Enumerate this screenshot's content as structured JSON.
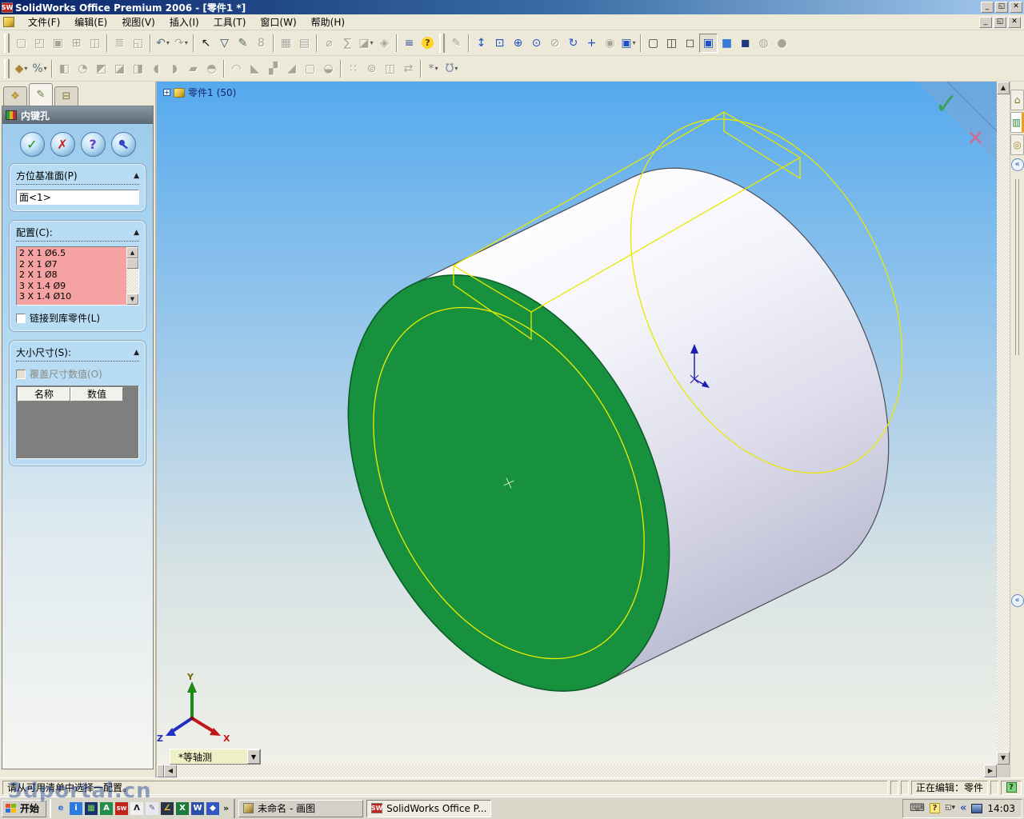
{
  "window": {
    "title": "SolidWorks Office Premium 2006 - [零件1 *]"
  },
  "menu": [
    "文件(F)",
    "编辑(E)",
    "视图(V)",
    "插入(I)",
    "工具(T)",
    "窗口(W)",
    "帮助(H)"
  ],
  "toolbars": {
    "row1": [
      {
        "grip": true
      },
      {
        "n": "new-document-icon",
        "g": "▢",
        "c": "#9a9a8c",
        "s": "off"
      },
      {
        "n": "open-document-icon",
        "g": "◰",
        "c": "#a89a6a",
        "s": "off"
      },
      {
        "n": "save-icon",
        "g": "▣",
        "c": "#9a9a8c",
        "s": "off"
      },
      {
        "n": "make-drawing-icon",
        "g": "⊞",
        "c": "#9a9a8c",
        "s": "off"
      },
      {
        "n": "make-assembly-icon",
        "g": "◫",
        "c": "#9a9a8c",
        "s": "off"
      },
      {
        "sep": true
      },
      {
        "n": "print-icon",
        "g": "≣",
        "c": "#9a9a8c",
        "s": "off"
      },
      {
        "n": "print-preview-icon",
        "g": "◱",
        "c": "#9a9a8c",
        "s": "off"
      },
      {
        "sep": true
      },
      {
        "n": "undo-icon",
        "g": "↶",
        "c": "#5a748e",
        "s": "on",
        "caret": true
      },
      {
        "n": "redo-icon",
        "g": "↷",
        "c": "#a0a094",
        "s": "off",
        "caret": true
      },
      {
        "sep": true
      },
      {
        "n": "select-icon",
        "g": "↖",
        "c": "#1a1a1a",
        "s": "on"
      },
      {
        "n": "select-filter-icon",
        "g": "▽",
        "c": "#3a4a6a",
        "s": "on"
      },
      {
        "n": "sketch-icon",
        "g": "✎",
        "c": "#5a6a5a",
        "s": "on"
      },
      {
        "n": "bead-icon",
        "g": "8",
        "c": "#9a9a8c",
        "s": "off"
      },
      {
        "sep": true
      },
      {
        "n": "grid-icon",
        "g": "▦",
        "c": "#9a9a8c",
        "s": "off"
      },
      {
        "n": "hatch-icon",
        "g": "▤",
        "c": "#a89a7a",
        "s": "off"
      },
      {
        "sep": true
      },
      {
        "n": "measure-icon",
        "g": "⌀",
        "c": "#9a9a8c",
        "s": "off"
      },
      {
        "n": "mass-properties-icon",
        "g": "∑",
        "c": "#9a9a8c",
        "s": "off"
      },
      {
        "n": "section-properties-icon",
        "g": "◪",
        "c": "#9a9a8c",
        "s": "off",
        "caret": true
      },
      {
        "n": "check-icon",
        "g": "◈",
        "c": "#9a9a8c",
        "s": "off"
      },
      {
        "sep": true
      },
      {
        "n": "options-icon",
        "g": "≡",
        "c": "#3a5aa0",
        "s": "on"
      },
      {
        "n": "help-icon",
        "g": "?",
        "c": "#5a3a00",
        "s": "on",
        "help": true
      },
      {
        "grip": true
      },
      {
        "n": "smart-fasteners-icon",
        "g": "✎",
        "c": "#a0a094",
        "s": "off"
      },
      {
        "sep": true
      },
      {
        "n": "zoom-fit-icon",
        "g": "↕",
        "c": "#2050c8",
        "s": "on"
      },
      {
        "n": "zoom-area-icon",
        "g": "⊡",
        "c": "#2050c8",
        "s": "on"
      },
      {
        "n": "zoom-in-out-icon",
        "g": "⊕",
        "c": "#2050c8",
        "s": "on"
      },
      {
        "n": "zoom-selected-icon",
        "g": "⊙",
        "c": "#2050c8",
        "s": "on"
      },
      {
        "n": "zoom-previous-icon",
        "g": "⊘",
        "c": "#a0a094",
        "s": "off"
      },
      {
        "n": "rotate-view-icon",
        "g": "↻",
        "c": "#2050c8",
        "s": "on"
      },
      {
        "n": "pan-icon",
        "g": "+",
        "c": "#2050c8",
        "s": "on"
      },
      {
        "n": "rotate-about-scene-icon",
        "g": "◉",
        "c": "#a0a094",
        "s": "off"
      },
      {
        "n": "standard-views-icon",
        "g": "▣",
        "c": "#2050c8",
        "s": "on",
        "caret": true
      },
      {
        "sep": true
      },
      {
        "n": "wireframe-icon",
        "g": "▢",
        "c": "#3a3a3a",
        "s": "on"
      },
      {
        "n": "hidden-lines-visible-icon",
        "g": "◫",
        "c": "#3a3a3a",
        "s": "on"
      },
      {
        "n": "hidden-lines-removed-icon",
        "g": "◻",
        "c": "#3a3a3a",
        "s": "on"
      },
      {
        "n": "shaded-with-edges-icon",
        "g": "▣",
        "c": "#2050c8",
        "s": "active"
      },
      {
        "n": "shaded-icon",
        "g": "■",
        "c": "#3a78d8",
        "s": "on"
      },
      {
        "n": "shadows-icon",
        "g": "◼",
        "c": "#1a3a78",
        "s": "on"
      },
      {
        "n": "section-view-icon",
        "g": "◍",
        "c": "#a0a094",
        "s": "off"
      },
      {
        "n": "realview-icon",
        "g": "●",
        "c": "#b8b4a8",
        "s": "off"
      }
    ],
    "row2": [
      {
        "grip": true
      },
      {
        "n": "hole-series-icon",
        "g": "◆",
        "c": "#a8863a",
        "s": "on",
        "caret": true
      },
      {
        "n": "dimension-tools-icon",
        "g": "%",
        "c": "#5a6a7a",
        "s": "on",
        "caret": true
      },
      {
        "sep": true
      },
      {
        "n": "extruded-boss-icon",
        "g": "◧",
        "c": "#a0a094",
        "s": "off"
      },
      {
        "n": "revolved-boss-icon",
        "g": "◔",
        "c": "#a0a094",
        "s": "off"
      },
      {
        "n": "swept-boss-icon",
        "g": "◩",
        "c": "#a0a094",
        "s": "off"
      },
      {
        "n": "lofted-boss-icon",
        "g": "◪",
        "c": "#a0a094",
        "s": "off"
      },
      {
        "n": "extruded-cut-icon",
        "g": "◨",
        "c": "#a0a094",
        "s": "off"
      },
      {
        "n": "revolved-cut-icon",
        "g": "◖",
        "c": "#a0a094",
        "s": "off"
      },
      {
        "n": "swept-cut-icon",
        "g": "◗",
        "c": "#a0a094",
        "s": "off"
      },
      {
        "n": "lofted-cut-icon",
        "g": "▰",
        "c": "#a0a094",
        "s": "off"
      },
      {
        "n": "shape-feature-icon",
        "g": "◓",
        "c": "#a0a094",
        "s": "off"
      },
      {
        "sep": true
      },
      {
        "n": "fillet-icon",
        "g": "◠",
        "c": "#a0a094",
        "s": "off"
      },
      {
        "n": "chamfer-icon",
        "g": "◣",
        "c": "#a0a094",
        "s": "off"
      },
      {
        "n": "rib-icon",
        "g": "▞",
        "c": "#a0a094",
        "s": "off"
      },
      {
        "n": "draft-icon",
        "g": "◢",
        "c": "#a0a094",
        "s": "off"
      },
      {
        "n": "shell-icon",
        "g": "▢",
        "c": "#a0a094",
        "s": "off"
      },
      {
        "n": "dome-icon",
        "g": "◒",
        "c": "#a0a094",
        "s": "off"
      },
      {
        "sep": true
      },
      {
        "n": "linear-pattern-icon",
        "g": "∷",
        "c": "#a0a094",
        "s": "off"
      },
      {
        "n": "circular-pattern-icon",
        "g": "⊚",
        "c": "#a0a094",
        "s": "off"
      },
      {
        "n": "mirror-feature-icon",
        "g": "◫",
        "c": "#a0a094",
        "s": "off"
      },
      {
        "n": "move-face-icon",
        "g": "⇄",
        "c": "#a0a094",
        "s": "off"
      },
      {
        "sep": true
      },
      {
        "n": "reference-geometry-icon",
        "g": "*",
        "c": "#7a8aa0",
        "s": "on",
        "caret": true
      },
      {
        "n": "curves-icon",
        "g": "Ʊ",
        "c": "#7a8aa0",
        "s": "on",
        "caret": true
      }
    ]
  },
  "pm": {
    "title": "内键孔",
    "group1_label": "方位基准面(P)",
    "face_value": "面<1>",
    "group2_label": "配置(C):",
    "configs": [
      "2 X 1  Ø6.5",
      "2 X 1  Ø7",
      "2 X 1  Ø8",
      "3 X 1.4  Ø9",
      "3 X 1.4  Ø10"
    ],
    "link_label": "链接到库零件(L)",
    "group3_label": "大小尺寸(S):",
    "override_label": "覆盖尺寸数值(O)",
    "col_name": "名称",
    "col_value": "数值"
  },
  "viewport": {
    "tree_item": "零件1",
    "tree_count": "(50)",
    "orientation": "*等轴测"
  },
  "triad": {
    "x": "X",
    "y": "Y",
    "z": "Z"
  },
  "statusbar": {
    "message": "请从可用清单中选择一配置。",
    "editing": "正在编辑：零件"
  },
  "taskbar": {
    "start": "开始",
    "task1": "未命名 - 画图",
    "task2": "SolidWorks Office P...",
    "clock": "14:03",
    "quicklaunch": [
      {
        "n": "ie-icon",
        "g": "e",
        "bg": "transparent",
        "fg": "#2a6fd6"
      },
      {
        "n": "messenger-icon",
        "g": "i",
        "bg": "#2a7ae0",
        "fg": "#ffffff"
      },
      {
        "n": "app1-icon",
        "g": "▦",
        "bg": "#16336e",
        "fg": "#7fd34a"
      },
      {
        "n": "cad-app-icon",
        "g": "A",
        "bg": "#1f8f4a",
        "fg": "#ffffff"
      },
      {
        "n": "solidworks-quicklaunch-icon",
        "g": "SW",
        "bg": "#c0241c",
        "fg": "#ffffff"
      },
      {
        "n": "lambda-app-icon",
        "g": "Λ",
        "bg": "#f0f0f0",
        "fg": "#101010"
      },
      {
        "n": "sketch-app-icon",
        "g": "✎",
        "bg": "#e8e8f0",
        "fg": "#666677"
      },
      {
        "n": "drafting-app-icon",
        "g": "∠",
        "bg": "#2a3448",
        "fg": "#ffcc33"
      },
      {
        "n": "excel-icon",
        "g": "X",
        "bg": "#1c7a3c",
        "fg": "#ffffff"
      },
      {
        "n": "word-icon",
        "g": "W",
        "bg": "#2b4fa8",
        "fg": "#ffffff"
      },
      {
        "n": "media-app-icon",
        "g": "◆",
        "bg": "#3558c0",
        "fg": "#ffffff"
      }
    ]
  },
  "colors": {
    "selected_face_green": "#18913e",
    "preview_yellow": "#e8e800",
    "viewport_top_blue": "#55a9ee",
    "config_list_pink": "#f4a2a2"
  },
  "watermark": {
    "text": "3dportal.cn"
  }
}
